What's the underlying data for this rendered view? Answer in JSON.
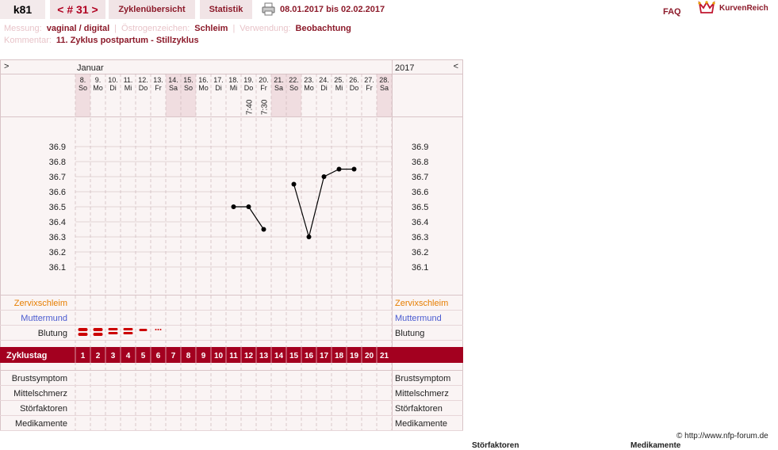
{
  "header": {
    "user": "k81",
    "cycle_nav": "< # 31 >",
    "tab_overview": "Zyklenübersicht",
    "tab_stats": "Statistik",
    "date_range": "08.01.2017 bis 02.02.2017",
    "faq": "FAQ",
    "brand": "KurvenReich"
  },
  "meta": {
    "measurement_label": "Messung:",
    "measurement_value": "vaginal / digital",
    "estrogen_label": "Östrogenzeichen:",
    "estrogen_value": "Schleim",
    "usage_label": "Verwendung:",
    "usage_value": "Beobachtung",
    "comment_label": "Kommentar:",
    "comment_value": "11. Zyklus postpartum - Stillzyklus"
  },
  "chart": {
    "nav_left": ">",
    "nav_right": "<",
    "month": "Januar",
    "year": "2017",
    "days": [
      {
        "d": "8.",
        "w": "So",
        "we": true
      },
      {
        "d": "9.",
        "w": "Mo",
        "we": false
      },
      {
        "d": "10.",
        "w": "Di",
        "we": false
      },
      {
        "d": "11.",
        "w": "Mi",
        "we": false
      },
      {
        "d": "12.",
        "w": "Do",
        "we": false
      },
      {
        "d": "13.",
        "w": "Fr",
        "we": false
      },
      {
        "d": "14.",
        "w": "Sa",
        "we": true
      },
      {
        "d": "15.",
        "w": "So",
        "we": true
      },
      {
        "d": "16.",
        "w": "Mo",
        "we": false
      },
      {
        "d": "17.",
        "w": "Di",
        "we": false
      },
      {
        "d": "18.",
        "w": "Mi",
        "we": false
      },
      {
        "d": "19.",
        "w": "Do",
        "we": false
      },
      {
        "d": "20.",
        "w": "Fr",
        "we": false
      },
      {
        "d": "21.",
        "w": "Sa",
        "we": true
      },
      {
        "d": "22.",
        "w": "So",
        "we": true
      },
      {
        "d": "23.",
        "w": "Mo",
        "we": false
      },
      {
        "d": "24.",
        "w": "Di",
        "we": false
      },
      {
        "d": "25.",
        "w": "Mi",
        "we": false
      },
      {
        "d": "26.",
        "w": "Do",
        "we": false
      },
      {
        "d": "27.",
        "w": "Fr",
        "we": false
      },
      {
        "d": "28.",
        "w": "Sa",
        "we": true
      }
    ],
    "times": [
      {
        "day_index": 11,
        "t": "7:40"
      },
      {
        "day_index": 12,
        "t": "7:30"
      }
    ],
    "y_ticks": [
      "36.9",
      "36.8",
      "36.7",
      "36.6",
      "36.5",
      "36.4",
      "36.3",
      "36.2",
      "36.1"
    ],
    "rows": {
      "zervix": "Zervixschleim",
      "muttermund": "Muttermund",
      "blutung": "Blutung",
      "zyklustag": "Zyklustag",
      "brust": "Brustsymptom",
      "mittel": "Mittelschmerz",
      "stoer": "Störfaktoren",
      "medi": "Medikamente"
    },
    "cycle_days": [
      "1",
      "2",
      "3",
      "4",
      "5",
      "6",
      "7",
      "8",
      "9",
      "10",
      "11",
      "12",
      "13",
      "14",
      "15",
      "16",
      "17",
      "18",
      "19",
      "20",
      "21"
    ],
    "bleeding": [
      "heavy",
      "heavy",
      "medium",
      "medium",
      "light",
      "spotting",
      "",
      "",
      "",
      "",
      "",
      "",
      "",
      "",
      "",
      "",
      "",
      "",
      "",
      "",
      ""
    ],
    "colors": {
      "accent": "#a3001f",
      "weekend": "#f0dde0",
      "zervix": "#e67e00",
      "muttermund": "#4a5bd0",
      "bleed": "#cc0000"
    }
  },
  "chart_data": {
    "type": "line",
    "x": [
      "8.",
      "9.",
      "10.",
      "11.",
      "12.",
      "13.",
      "14.",
      "15.",
      "16.",
      "17.",
      "18.",
      "19.",
      "20.",
      "21.",
      "22.",
      "23.",
      "24.",
      "25.",
      "26.",
      "27.",
      "28."
    ],
    "series": [
      {
        "values": [
          null,
          null,
          null,
          null,
          null,
          null,
          null,
          null,
          null,
          null,
          36.5,
          36.5,
          36.35,
          null,
          36.65,
          36.3,
          36.7,
          36.75,
          36.75,
          null,
          null
        ],
        "segments": [
          [
            10,
            12
          ],
          [
            14,
            18
          ]
        ]
      }
    ],
    "ylim": [
      36.1,
      36.9
    ]
  },
  "footer": {
    "copyright": "© http://www.nfp-forum.de",
    "cut_left": "Störfaktoren",
    "cut_right": "Medikamente"
  }
}
